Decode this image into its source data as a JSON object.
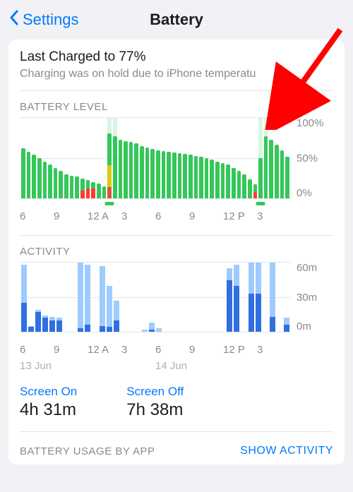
{
  "nav": {
    "back_label": "Settings",
    "title": "Battery"
  },
  "summary": {
    "last_charged": "Last Charged to 77%",
    "subtext": "Charging was on hold due to iPhone temperatu"
  },
  "battery_chart": {
    "header": "BATTERY LEVEL",
    "yticks": [
      "100%",
      "50%",
      "0%"
    ],
    "xticks": [
      "6",
      "9",
      "12 A",
      "3",
      "6",
      "9",
      "12 P",
      "3"
    ]
  },
  "activity_chart": {
    "header": "ACTIVITY",
    "yticks": [
      "60m",
      "30m",
      "0m"
    ],
    "xticks": [
      "6",
      "9",
      "12 A",
      "3",
      "6",
      "9",
      "12 P",
      "3"
    ],
    "xdates": [
      "13 Jun",
      "14 Jun"
    ]
  },
  "stats": {
    "screen_on_label": "Screen On",
    "screen_on_value": "4h 31m",
    "screen_off_label": "Screen Off",
    "screen_off_value": "7h 38m"
  },
  "footer": {
    "usage_label": "BATTERY USAGE BY APP",
    "show_activity": "SHOW ACTIVITY"
  },
  "colors": {
    "link": "#007aff",
    "green": "#34c759",
    "yellow": "#ffcc00",
    "red": "#ff3b30",
    "act_light": "#9ecbff",
    "act_dark": "#2f6fe0"
  },
  "chart_data": [
    {
      "type": "bar",
      "title": "BATTERY LEVEL",
      "ylabel": "%",
      "ylim": [
        0,
        100
      ],
      "bars": [
        {
          "segments": [
            {
              "h": 62,
              "c": "green"
            }
          ]
        },
        {
          "segments": [
            {
              "h": 58,
              "c": "green"
            }
          ]
        },
        {
          "segments": [
            {
              "h": 54,
              "c": "green"
            }
          ]
        },
        {
          "segments": [
            {
              "h": 50,
              "c": "green"
            }
          ]
        },
        {
          "segments": [
            {
              "h": 46,
              "c": "green"
            }
          ]
        },
        {
          "segments": [
            {
              "h": 42,
              "c": "green"
            }
          ]
        },
        {
          "segments": [
            {
              "h": 38,
              "c": "green"
            }
          ]
        },
        {
          "segments": [
            {
              "h": 34,
              "c": "green"
            }
          ]
        },
        {
          "segments": [
            {
              "h": 30,
              "c": "green"
            }
          ]
        },
        {
          "segments": [
            {
              "h": 28,
              "c": "green"
            }
          ]
        },
        {
          "segments": [
            {
              "h": 27,
              "c": "green"
            }
          ]
        },
        {
          "segments": [
            {
              "h": 10,
              "c": "red"
            },
            {
              "h": 15,
              "c": "green"
            }
          ]
        },
        {
          "segments": [
            {
              "h": 12,
              "c": "red"
            },
            {
              "h": 11,
              "c": "green"
            }
          ]
        },
        {
          "segments": [
            {
              "h": 12,
              "c": "red"
            },
            {
              "h": 8,
              "c": "green"
            }
          ]
        },
        {
          "segments": [
            {
              "h": 18,
              "c": "green"
            }
          ]
        },
        {
          "segments": [
            {
              "h": 15,
              "c": "green"
            }
          ]
        },
        {
          "segments": [
            {
              "h": 14,
              "c": "red"
            },
            {
              "h": 27,
              "c": "yellow"
            },
            {
              "h": 40,
              "c": "green"
            }
          ],
          "charging": true,
          "tick": true
        },
        {
          "segments": [
            {
              "h": 77,
              "c": "green"
            }
          ],
          "charging": true
        },
        {
          "segments": [
            {
              "h": 73,
              "c": "green"
            }
          ]
        },
        {
          "segments": [
            {
              "h": 71,
              "c": "green"
            }
          ]
        },
        {
          "segments": [
            {
              "h": 70,
              "c": "green"
            }
          ]
        },
        {
          "segments": [
            {
              "h": 68,
              "c": "green"
            }
          ]
        },
        {
          "segments": [
            {
              "h": 65,
              "c": "green"
            }
          ]
        },
        {
          "segments": [
            {
              "h": 63,
              "c": "green"
            }
          ]
        },
        {
          "segments": [
            {
              "h": 61,
              "c": "green"
            }
          ]
        },
        {
          "segments": [
            {
              "h": 60,
              "c": "green"
            }
          ]
        },
        {
          "segments": [
            {
              "h": 59,
              "c": "green"
            }
          ]
        },
        {
          "segments": [
            {
              "h": 58,
              "c": "green"
            }
          ]
        },
        {
          "segments": [
            {
              "h": 57,
              "c": "green"
            }
          ]
        },
        {
          "segments": [
            {
              "h": 56,
              "c": "green"
            }
          ]
        },
        {
          "segments": [
            {
              "h": 55,
              "c": "green"
            }
          ]
        },
        {
          "segments": [
            {
              "h": 54,
              "c": "green"
            }
          ]
        },
        {
          "segments": [
            {
              "h": 53,
              "c": "green"
            }
          ]
        },
        {
          "segments": [
            {
              "h": 52,
              "c": "green"
            }
          ]
        },
        {
          "segments": [
            {
              "h": 50,
              "c": "green"
            }
          ]
        },
        {
          "segments": [
            {
              "h": 48,
              "c": "green"
            }
          ]
        },
        {
          "segments": [
            {
              "h": 46,
              "c": "green"
            }
          ]
        },
        {
          "segments": [
            {
              "h": 44,
              "c": "green"
            }
          ]
        },
        {
          "segments": [
            {
              "h": 42,
              "c": "green"
            }
          ]
        },
        {
          "segments": [
            {
              "h": 38,
              "c": "green"
            }
          ]
        },
        {
          "segments": [
            {
              "h": 34,
              "c": "green"
            }
          ]
        },
        {
          "segments": [
            {
              "h": 30,
              "c": "green"
            }
          ]
        },
        {
          "segments": [
            {
              "h": 24,
              "c": "green"
            }
          ]
        },
        {
          "segments": [
            {
              "h": 8,
              "c": "red"
            },
            {
              "h": 10,
              "c": "green"
            }
          ]
        },
        {
          "segments": [
            {
              "h": 50,
              "c": "green"
            }
          ],
          "charging": true,
          "tick": true
        },
        {
          "segments": [
            {
              "h": 77,
              "c": "green"
            }
          ],
          "charging": true
        },
        {
          "segments": [
            {
              "h": 73,
              "c": "green"
            }
          ]
        },
        {
          "segments": [
            {
              "h": 67,
              "c": "green"
            }
          ]
        },
        {
          "segments": [
            {
              "h": 60,
              "c": "green"
            }
          ]
        },
        {
          "segments": [
            {
              "h": 52,
              "c": "green"
            }
          ]
        }
      ]
    },
    {
      "type": "bar",
      "title": "ACTIVITY",
      "ylabel": "minutes",
      "ylim": [
        0,
        60
      ],
      "bars": [
        {
          "on": 25,
          "off": 33
        },
        {
          "on": 4,
          "off": 1
        },
        {
          "on": 17,
          "off": 2
        },
        {
          "on": 12,
          "off": 2
        },
        {
          "on": 10,
          "off": 3
        },
        {
          "on": 10,
          "off": 2
        },
        {
          "on": 0,
          "off": 0
        },
        {
          "on": 0,
          "off": 0
        },
        {
          "on": 3,
          "off": 57
        },
        {
          "on": 6,
          "off": 52
        },
        {
          "on": 0,
          "off": 0
        },
        {
          "on": 5,
          "off": 52
        },
        {
          "on": 4,
          "off": 36
        },
        {
          "on": 10,
          "off": 17
        },
        {
          "on": 0,
          "off": 0
        },
        {
          "on": 0,
          "off": 0
        },
        {
          "on": 0,
          "off": 0
        },
        {
          "on": 0,
          "off": 2
        },
        {
          "on": 2,
          "off": 6
        },
        {
          "on": 0,
          "off": 3
        },
        {
          "on": 0,
          "off": 0
        },
        {
          "on": 0,
          "off": 0
        },
        {
          "on": 0,
          "off": 0
        },
        {
          "on": 0,
          "off": 0
        },
        {
          "on": 0,
          "off": 0
        },
        {
          "on": 0,
          "off": 0
        },
        {
          "on": 0,
          "off": 0
        },
        {
          "on": 0,
          "off": 0
        },
        {
          "on": 0,
          "off": 0
        },
        {
          "on": 45,
          "off": 10
        },
        {
          "on": 40,
          "off": 18
        },
        {
          "on": 0,
          "off": 0
        },
        {
          "on": 33,
          "off": 27
        },
        {
          "on": 33,
          "off": 27
        },
        {
          "on": 0,
          "off": 0
        },
        {
          "on": 13,
          "off": 47
        },
        {
          "on": 0,
          "off": 0
        },
        {
          "on": 6,
          "off": 6
        }
      ]
    }
  ]
}
